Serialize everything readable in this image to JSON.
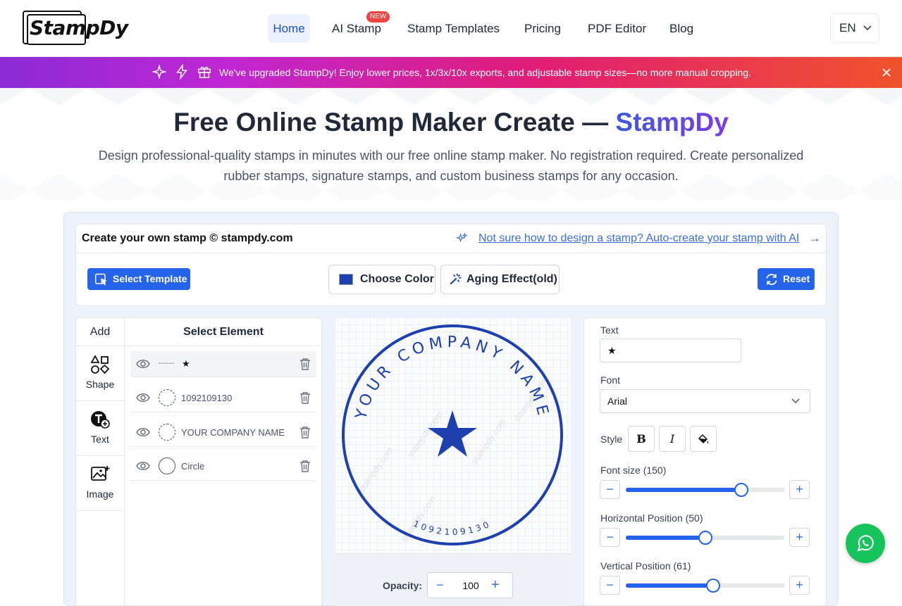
{
  "header": {
    "logo_text": "StampDy",
    "nav": [
      {
        "label": "Home",
        "active": true
      },
      {
        "label": "AI Stamp",
        "badge": "NEW"
      },
      {
        "label": "Stamp Templates"
      },
      {
        "label": "Pricing"
      },
      {
        "label": "PDF Editor"
      },
      {
        "label": "Blog"
      }
    ],
    "language": "EN"
  },
  "banner": {
    "text": "We've upgraded StampDy! Enjoy lower prices, 1x/3x/10x exports, and adjustable stamp sizes—no more manual cropping.",
    "icons": [
      "sparkle-icon",
      "lightning-icon",
      "gift-icon"
    ],
    "close_icon": "close-icon"
  },
  "hero": {
    "title_main": "Free Online Stamp Maker Create — ",
    "title_accent": "StampDy",
    "subtitle": "Design professional-quality stamps in minutes with our free online stamp maker. No registration required. Create personalized rubber stamps, signature stamps, and custom business stamps for any occasion."
  },
  "editor": {
    "title": "Create your own stamp © stampdy.com",
    "ai_link": "Not sure how to design a stamp? Auto-create your stamp with AI",
    "ai_arrow": "→",
    "toolbar": {
      "select_template": "Select Template",
      "choose_color": "Choose Color",
      "aging_effect": "Aging Effect(old)",
      "reset": "Reset"
    },
    "add_panel": {
      "heading": "Add",
      "items": [
        {
          "label": "Shape",
          "icon": "shapes-icon"
        },
        {
          "label": "Text",
          "icon": "text-add-icon"
        },
        {
          "label": "Image",
          "icon": "image-add-icon"
        }
      ]
    },
    "elements_panel": {
      "heading": "Select Element",
      "items": [
        {
          "label": "★",
          "prefix": "------"
        },
        {
          "label": "1092109130"
        },
        {
          "label": "YOUR COMPANY NAME"
        },
        {
          "label": "Circle"
        }
      ]
    },
    "stamp": {
      "top_text": "YOUR COMPANY NAME",
      "bottom_text": "1092109130",
      "center": "★",
      "color": "#1e40af",
      "watermark": "stampdy.com"
    },
    "opacity": {
      "label": "Opacity:",
      "value": "100"
    },
    "properties": {
      "text_label": "Text",
      "text_value": "★",
      "font_label": "Font",
      "font_value": "Arial",
      "style_label": "Style",
      "style_buttons": [
        "B",
        "I",
        "fill-icon"
      ],
      "sliders": [
        {
          "label": "Font size (150)",
          "value": 150,
          "fraction": 0.73
        },
        {
          "label": "Horizontal Position (50)",
          "value": 50,
          "fraction": 0.5
        },
        {
          "label": "Vertical Position (61)",
          "value": 61,
          "fraction": 0.55
        }
      ]
    }
  },
  "accent_color": "#2563eb"
}
